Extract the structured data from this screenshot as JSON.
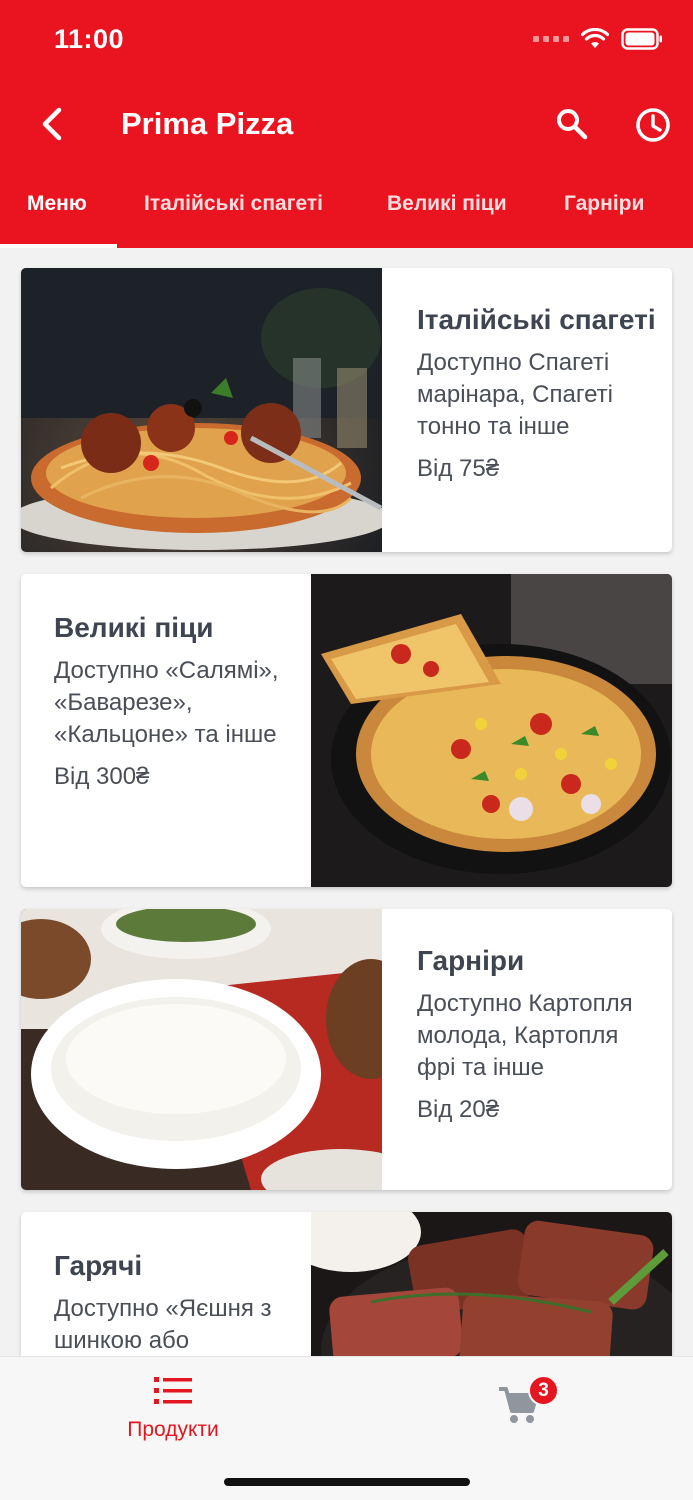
{
  "status_bar": {
    "time": "11:00"
  },
  "header": {
    "title": "Prima Pizza"
  },
  "tabs": [
    {
      "label": "Меню"
    },
    {
      "label": "Італійські спагеті"
    },
    {
      "label": "Великі піци"
    },
    {
      "label": "Гарніри"
    }
  ],
  "cards": [
    {
      "title": "Італійські спагеті",
      "description": "Доступно Спагеті марінара, Спагеті тонно та інше",
      "price": "Від 75₴",
      "image": "spaghetti-photo"
    },
    {
      "title": "Великі піци",
      "description": "Доступно «Салямі», «Баварезе», «Кальцоне» та інше",
      "price": "Від 300₴",
      "image": "pizza-photo"
    },
    {
      "title": "Гарніри",
      "description": "Доступно Картопля молода, Картопля фрі та інше",
      "price": "Від 20₴",
      "image": "rice-photo"
    },
    {
      "title": "Гарячі",
      "description": "Доступно «Яєшня з шинкою або",
      "price": "",
      "image": "steak-photo"
    }
  ],
  "bottom_nav": {
    "products_label": "Продукти",
    "cart_count": "3"
  },
  "colors": {
    "accent": "#ea1420",
    "text": "#4a4f57"
  }
}
